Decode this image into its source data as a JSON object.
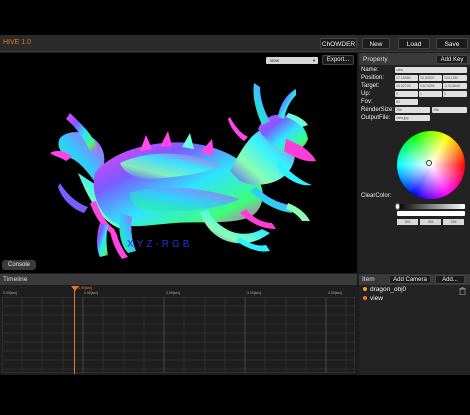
{
  "app": {
    "title": "HIVE 1.0"
  },
  "toolbar": {
    "chowder": "ChOWDER",
    "new": "New",
    "load": "Load",
    "save": "Save"
  },
  "viewport": {
    "view_select": "view",
    "export_label": "Export...",
    "overlay_text": "XYZ-RGB",
    "console_label": "Console"
  },
  "property": {
    "title": "Property",
    "add_key": "Add Key",
    "rows": {
      "name": {
        "label": "Name:",
        "value": "view"
      },
      "position": {
        "label": "Position:",
        "values": [
          "17.18980",
          "10.93037",
          "104.1857"
        ]
      },
      "target": {
        "label": "Target:",
        "values": [
          "10.32703",
          "9.674056",
          "-0.913649"
        ]
      },
      "up": {
        "label": "Up:",
        "values": [
          "0",
          "1",
          "0"
        ]
      },
      "fov": {
        "label": "Fov:",
        "value": "60"
      },
      "render_size": {
        "label": "RenderSize:",
        "values": [
          "256",
          "256"
        ]
      },
      "output_file": {
        "label": "OutputFile:",
        "value": "view.jpg"
      },
      "clear_color": {
        "label": "ClearColor:"
      }
    },
    "color_fields": [
      "255",
      "255",
      "255",
      "255"
    ]
  },
  "timeline": {
    "title": "Timeline",
    "ticks": [
      "0.00[sec]",
      "1.00[sec]",
      "2.00[sec]",
      "3.00[sec]",
      "4.00[sec]"
    ],
    "playhead_label": "0.96[sec]"
  },
  "item": {
    "title": "Item",
    "add_camera": "Add Camera",
    "add_more": "Add...",
    "rows": [
      {
        "label": "dragon_obj0",
        "color": "#e8a23a"
      },
      {
        "label": "view",
        "color": "#e8762b"
      }
    ]
  },
  "colors": {
    "accent": "#e8762b",
    "overlay_text": "#1f33e6"
  }
}
